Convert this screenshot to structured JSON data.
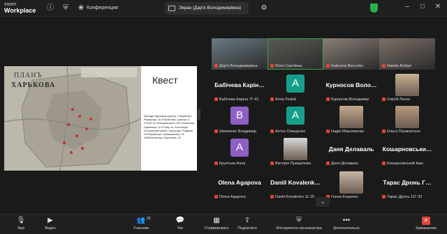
{
  "topbar": {
    "logo_line1": "zoom",
    "logo_line2": "Workplace",
    "conference_label": "Конференция",
    "screen_tab_label": "Экран (Дар'я Володимирівна)"
  },
  "shared_screen": {
    "map_title": "ПЛАНЪ",
    "map_city": "ХАРЬКОВА",
    "quest_title": "Квест",
    "quest_text": "Заклади Партнерів проекту: 1.Музей вул. Римарська, 15 2.Музей вул. Сумська, 4 3.ХНАТ ім. Котляревського, 2/5 4.Музей вул. Скрипника, 10 5.Театр пл. Конституції 6.Історичний музей 7.Центр вул. Різдвяна, 10 8.Музей вул. Чернишевська, 18 9.Бібліотека вул. Короленка, 18"
  },
  "participants": [
    {
      "name": "Дар'я Володимирівна",
      "big": "",
      "letter": "",
      "kind": "photo",
      "color": "#6b7a84"
    },
    {
      "name": "Юлія Сергіївна",
      "big": "",
      "letter": "",
      "kind": "photo",
      "color": "#5a5a55",
      "active": true
    },
    {
      "name": "Kateryna Boryzsko",
      "big": "",
      "letter": "",
      "kind": "photo",
      "color": "#8a7f78"
    },
    {
      "name": "Natalia Bulbyn",
      "big": "",
      "letter": "",
      "kind": "photo",
      "color": "#7d7068"
    },
    {
      "name": "Бабічева Каріна 7Г-41",
      "big": "Бабічева Карін…",
      "letter": "",
      "kind": "text",
      "color": ""
    },
    {
      "name": "Алла Fedub",
      "big": "",
      "letter": "A",
      "kind": "letter",
      "color": "#159e8c"
    },
    {
      "name": "Курносов Володимир",
      "big": "Курносов Воло…",
      "letter": "",
      "kind": "text",
      "color": ""
    },
    {
      "name": "Сергій Лиска",
      "big": "",
      "letter": "",
      "kind": "photo",
      "color": "#c8b090"
    },
    {
      "name": "Шевченко Владимир",
      "big": "",
      "letter": "B",
      "kind": "letter",
      "color": "#8e5fc4"
    },
    {
      "name": "Антон Онищенко",
      "big": "",
      "letter": "A",
      "kind": "letter",
      "color": "#159e8c"
    },
    {
      "name": "Надія Максименко",
      "big": "",
      "letter": "",
      "kind": "photo",
      "color": "#c4a78d"
    },
    {
      "name": "Ольга Пасмокітько",
      "big": "",
      "letter": "",
      "kind": "photo",
      "color": "#b89a80"
    },
    {
      "name": "Крупська Анна",
      "big": "",
      "letter": "A",
      "kind": "letter",
      "color": "#8e5fc4"
    },
    {
      "name": "Вікторія Прищепова",
      "big": "",
      "letter": "",
      "kind": "photo",
      "color": "#d8d8d8"
    },
    {
      "name": "Даня Делаваль",
      "big": "Даня Делаваль",
      "letter": "",
      "kind": "text",
      "color": ""
    },
    {
      "name": "Кошарновський Іван",
      "big": "Кошарновськи…",
      "letter": "",
      "kind": "text",
      "color": ""
    },
    {
      "name": "Olena Agapova",
      "big": "Olena Agapova",
      "letter": "",
      "kind": "text",
      "color": ""
    },
    {
      "name": "Daniil Kovalenko 11-25",
      "big": "Daniil Kovalenk…",
      "letter": "",
      "kind": "text",
      "color": ""
    },
    {
      "name": "Ганна Кошенко",
      "big": "",
      "letter": "",
      "kind": "photo",
      "color": "#c7b7a6"
    },
    {
      "name": "Тарас Дронь 11Г-33",
      "big": "Тарас Дронь Г…",
      "letter": "",
      "kind": "text",
      "color": ""
    }
  ],
  "toolbar": {
    "audio_label": "Звук",
    "video_label": "Видео",
    "participants_label": "Учасники",
    "participants_count": "29",
    "chat_label": "Чат",
    "record_label": "Стримировать",
    "share_label": "Поділитися",
    "host_tools_label": "Инструменти организатора",
    "more_label": "Дополнительно",
    "end_label": "Завершение"
  },
  "colors": {
    "mic_muted": "#e0463a",
    "active_speaker": "#3aa34a",
    "end": "#e0463a"
  }
}
